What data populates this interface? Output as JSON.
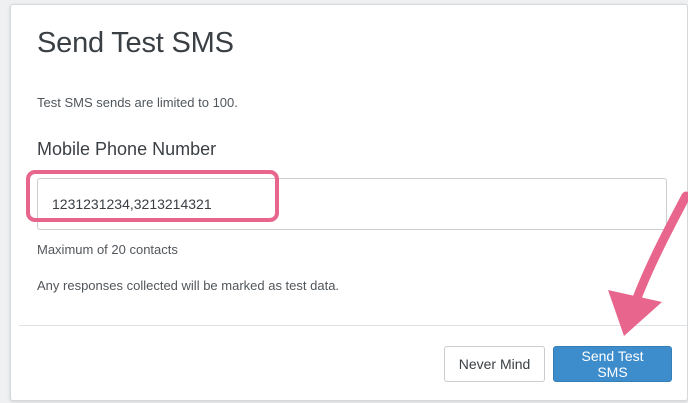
{
  "dialog": {
    "title": "Send Test SMS",
    "limit_note": "Test SMS sends are limited to 100.",
    "field_label": "Mobile Phone Number",
    "phone_input": {
      "value": "1231231234,3213214321",
      "placeholder": ""
    },
    "max_note": "Maximum of 20 contacts",
    "test_note": "Any responses collected will be marked as test data.",
    "buttons": {
      "cancel_label": "Never Mind",
      "submit_label": "Send Test SMS"
    }
  },
  "colors": {
    "accent": "#3d8ccc",
    "annotation": "#e8668e"
  },
  "annotations": {
    "highlight": "phone-input",
    "arrow": "send-test-sms-button"
  }
}
